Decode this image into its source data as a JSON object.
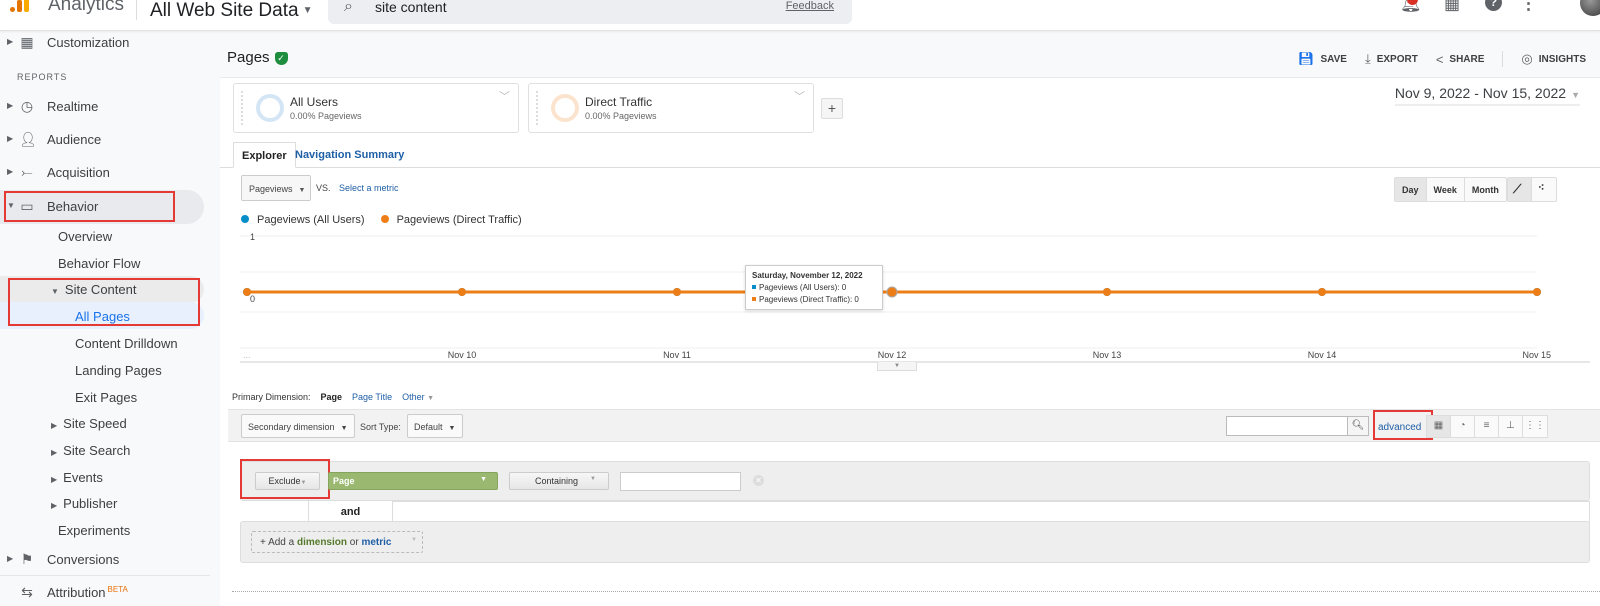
{
  "topbar": {
    "app_title": "Analytics",
    "property": "All Web Site Data",
    "search_value": "site content",
    "feedback": "Feedback",
    "icons": [
      "bell-icon",
      "apps-grid-icon",
      "help-icon",
      "more-vert-icon",
      "avatar"
    ]
  },
  "sidebar": {
    "customization": "Customization",
    "reports_label": "REPORTS",
    "items": [
      {
        "label": "Realtime",
        "icon": "clock-icon"
      },
      {
        "label": "Audience",
        "icon": "person-icon"
      },
      {
        "label": "Acquisition",
        "icon": "acquisition-icon"
      },
      {
        "label": "Behavior",
        "icon": "behavior-icon"
      }
    ],
    "behavior_sub": {
      "overview": "Overview",
      "behavior_flow": "Behavior Flow",
      "site_content": "Site Content",
      "all_pages": "All Pages",
      "content_drilldown": "Content Drilldown",
      "landing_pages": "Landing Pages",
      "exit_pages": "Exit Pages",
      "site_speed": "Site Speed",
      "site_search": "Site Search",
      "events": "Events",
      "publisher": "Publisher",
      "experiments": "Experiments"
    },
    "conversions": "Conversions",
    "attribution": "Attribution",
    "beta": "BETA"
  },
  "header": {
    "title": "Pages",
    "actions": {
      "save": "SAVE",
      "export": "EXPORT",
      "share": "SHARE",
      "insights": "INSIGHTS"
    }
  },
  "segments": [
    {
      "name": "All Users",
      "stat": "0.00% Pageviews",
      "color": "#d4e6f6"
    },
    {
      "name": "Direct Traffic",
      "stat": "0.00% Pageviews",
      "color": "#fbe3cd"
    }
  ],
  "add_segment": "+",
  "date_range": "Nov 9, 2022 - Nov 15, 2022",
  "tabs": {
    "explorer": "Explorer",
    "navigation_summary": "Navigation Summary"
  },
  "metric_controls": {
    "metric": "Pageviews",
    "vs": "VS.",
    "select_metric": "Select a metric",
    "period": [
      "Day",
      "Week",
      "Month"
    ],
    "period_selected": "Day"
  },
  "chart_data": {
    "type": "line",
    "title": "",
    "xlabel": "",
    "ylabel": "",
    "ylim": [
      0,
      1
    ],
    "y_ticks": [
      "0",
      "1"
    ],
    "x_ticks": [
      "...",
      "Nov 10",
      "Nov 11",
      "Nov 12",
      "Nov 13",
      "Nov 14",
      "Nov 15"
    ],
    "x": [
      "Nov 9",
      "Nov 10",
      "Nov 11",
      "Nov 12",
      "Nov 13",
      "Nov 14",
      "Nov 15"
    ],
    "legend_position": "top-left",
    "series": [
      {
        "name": "Pageviews (All Users)",
        "color": "#058dc7",
        "values": [
          0,
          0,
          0,
          0,
          0,
          0,
          0
        ]
      },
      {
        "name": "Pageviews (Direct Traffic)",
        "color": "#ed7e17",
        "values": [
          0,
          0,
          0,
          0,
          0,
          0,
          0
        ]
      }
    ],
    "tooltip": {
      "title": "Saturday, November 12, 2022",
      "lines": [
        "Pageviews (All Users): 0",
        "Pageviews (Direct Traffic): 0"
      ]
    }
  },
  "table_controls": {
    "primary_dimension_label": "Primary Dimension:",
    "primary_options": [
      "Page",
      "Page Title",
      "Other"
    ],
    "secondary_dimension": "Secondary dimension",
    "sort_type_label": "Sort Type:",
    "sort_type": "Default",
    "search_value": "",
    "advanced": "advanced"
  },
  "filter": {
    "mode": "Exclude",
    "dimension": "Page",
    "match_type": "Containing",
    "value": "",
    "and_label": "and",
    "add_prefix": "+ Add a ",
    "add_dimension": "dimension",
    "add_or": " or ",
    "add_metric": "metric"
  }
}
